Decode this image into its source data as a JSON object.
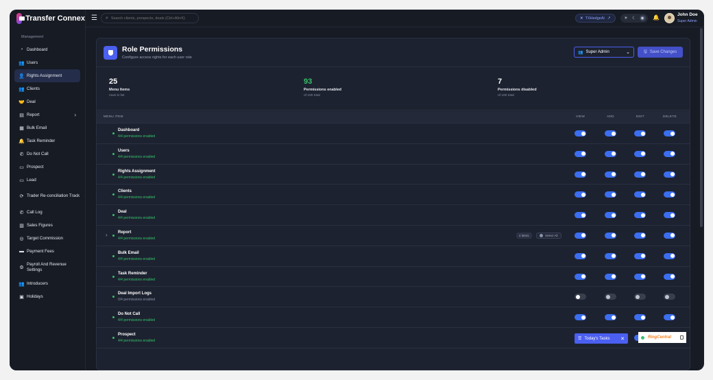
{
  "brand": {
    "name": "Transfer Connex"
  },
  "sidebar": {
    "section": "Management",
    "items": [
      {
        "label": "Dashboard",
        "icon": "dashboard-icon",
        "glyph": "◔"
      },
      {
        "label": "Users",
        "icon": "users-icon",
        "glyph": "👥"
      },
      {
        "label": "Rights Assignment",
        "icon": "rights-icon",
        "glyph": "👤",
        "active": true
      },
      {
        "label": "Clients",
        "icon": "clients-icon",
        "glyph": "👥"
      },
      {
        "label": "Deal",
        "icon": "deal-icon",
        "glyph": "🤝"
      },
      {
        "label": "Report",
        "icon": "report-icon",
        "glyph": "▤",
        "chevron": "›"
      },
      {
        "label": "Bulk Email",
        "icon": "bulk-email-icon",
        "glyph": "▦"
      },
      {
        "label": "Task Reminder",
        "icon": "task-reminder-icon",
        "glyph": "🔔"
      },
      {
        "label": "Do Not Call",
        "icon": "do-not-call-icon",
        "glyph": "✆"
      },
      {
        "label": "Prospect",
        "icon": "prospect-icon",
        "glyph": "▭"
      },
      {
        "label": "Lead",
        "icon": "lead-icon",
        "glyph": "▭"
      },
      {
        "label": "Trader Re-conciliation Track",
        "icon": "reconciliation-icon",
        "glyph": "⟳"
      },
      {
        "label": "Call Log",
        "icon": "call-log-icon",
        "glyph": "✆"
      },
      {
        "label": "Sales Figures",
        "icon": "sales-figures-icon",
        "glyph": "▥"
      },
      {
        "label": "Target Commission",
        "icon": "target-icon",
        "glyph": "◎"
      },
      {
        "label": "Payment Fees",
        "icon": "payment-icon",
        "glyph": "▬"
      },
      {
        "label": "Payroll And Revenue Settings",
        "icon": "payroll-icon",
        "glyph": "⚙"
      },
      {
        "label": "Introducers",
        "icon": "introducers-icon",
        "glyph": "👥"
      },
      {
        "label": "Holidays",
        "icon": "holidays-icon",
        "glyph": "▣"
      }
    ]
  },
  "topbar": {
    "search_placeholder": "Search clients, prospects, deals (Ctrl+Alt+K)",
    "workspace": "TXHedgeAi",
    "user_name": "John Doe",
    "user_role": "Super Admin"
  },
  "page": {
    "title": "Role Permissions",
    "subtitle": "Configure access rights for each user role",
    "role": "Super Admin",
    "save_label": "Save Changes"
  },
  "stats": [
    {
      "value": "25",
      "label": "Menu Items",
      "sub": "rows in list"
    },
    {
      "value": "93",
      "label": "Permissions enabled",
      "sub": "of 100 total"
    },
    {
      "value": "7",
      "label": "Permissions disabled",
      "sub": "of 100 total"
    }
  ],
  "table": {
    "headers": {
      "item": "MENU ITEM",
      "view": "VIEW",
      "add": "ADD",
      "edit": "EDIT",
      "delete": "DELETE"
    },
    "rows": [
      {
        "name": "Dashboard",
        "status": "4/4 permissions enabled",
        "perms": [
          true,
          true,
          true,
          true
        ]
      },
      {
        "name": "Users",
        "status": "4/4 permissions enabled",
        "perms": [
          true,
          true,
          true,
          true
        ]
      },
      {
        "name": "Rights Assignment",
        "status": "4/4 permissions enabled",
        "perms": [
          true,
          true,
          true,
          true
        ]
      },
      {
        "name": "Clients",
        "status": "4/4 permissions enabled",
        "perms": [
          true,
          true,
          true,
          true
        ]
      },
      {
        "name": "Deal",
        "status": "4/4 permissions enabled",
        "perms": [
          true,
          true,
          true,
          true
        ]
      },
      {
        "name": "Report",
        "status": "4/4 permissions enabled",
        "perms": [
          true,
          true,
          true,
          true
        ],
        "expandable": true,
        "items_chip": "4 items",
        "select_all": "Select All"
      },
      {
        "name": "Bulk Email",
        "status": "4/4 permissions enabled",
        "perms": [
          true,
          true,
          true,
          true
        ]
      },
      {
        "name": "Task Reminder",
        "status": "4/4 permissions enabled",
        "perms": [
          true,
          true,
          true,
          true
        ]
      },
      {
        "name": "Deal Import Logs",
        "status": "0/4 permissions enabled",
        "perms": [
          false,
          false,
          false,
          false
        ]
      },
      {
        "name": "Do Not Call",
        "status": "4/4 permissions enabled",
        "perms": [
          true,
          true,
          true,
          true
        ]
      },
      {
        "name": "Prospect",
        "status": "4/4 permissions enabled",
        "perms": [
          true,
          true,
          true,
          true
        ]
      }
    ]
  },
  "floating": {
    "tasks_label": "Today's Tasks",
    "ringcentral": "RingCentral"
  },
  "colors": {
    "accent": "#4b5ff0",
    "toggle_on": "#3b6ef0",
    "success": "#35c26a",
    "background": "#171b24"
  }
}
